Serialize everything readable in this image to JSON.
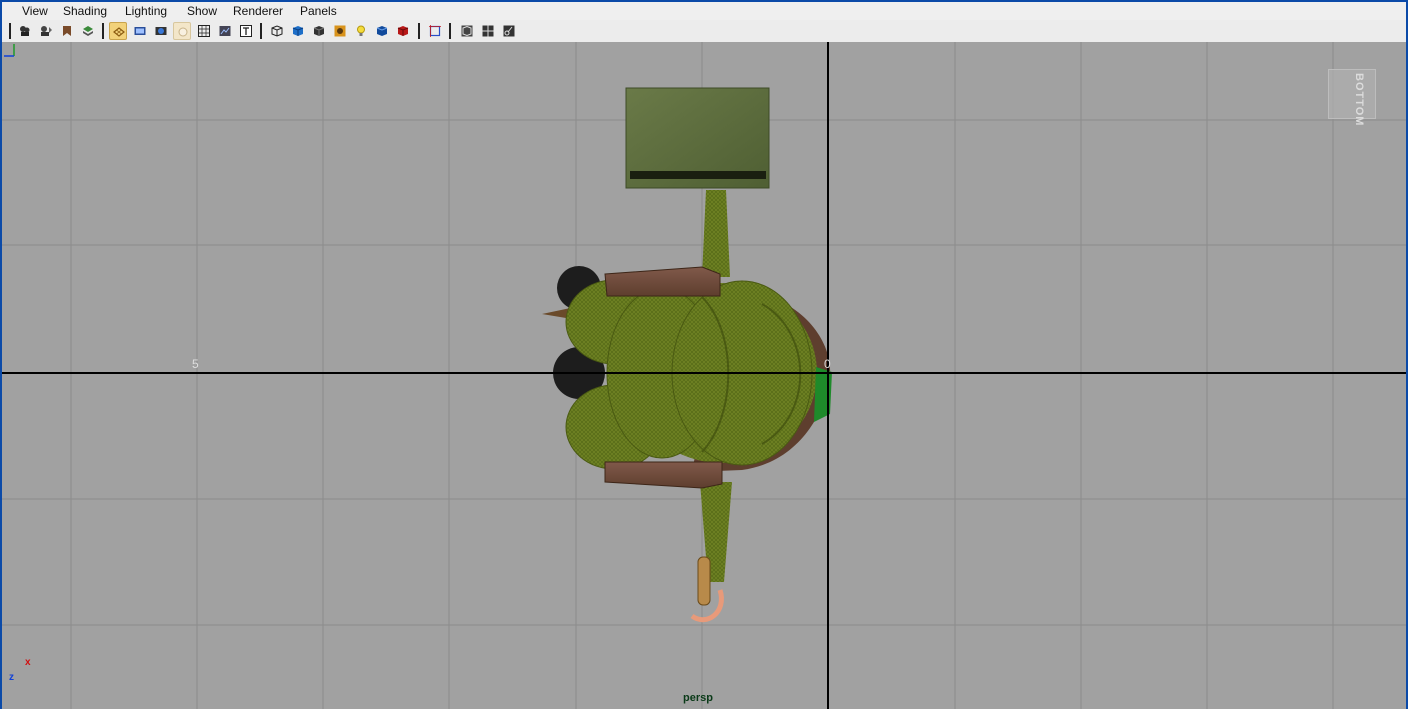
{
  "menubar": {
    "items": [
      "View",
      "Shading",
      "Lighting",
      "Show",
      "Renderer",
      "Panels"
    ]
  },
  "toolbar": {
    "icons": [
      "select-camera-icon",
      "camera-attributes-icon",
      "bookmark-icon",
      "image-plane-icon",
      "grid-icon",
      "film-gate-icon",
      "resolution-gate-icon",
      "gate-mask-icon",
      "wireframe-icon",
      "smooth-shade-icon",
      "texture-icon",
      "use-default-material-icon",
      "wireframe-on-shaded-icon",
      "smooth-shade-all-icon",
      "xray-icon",
      "shadows-icon",
      "all-lights-icon",
      "high-quality-icon",
      "isolate-select-icon",
      "single-view-icon",
      "four-view-icon",
      "outliner-layout-icon"
    ]
  },
  "viewport": {
    "view_cube_label": "BOTTOM",
    "grid_labels": {
      "left": "5",
      "origin": "0"
    },
    "camera_name": "persp",
    "axis_labels": {
      "x": "x",
      "z": "z"
    },
    "colors": {
      "background": "#a1a1a1",
      "grid": "#8a8a8a",
      "axis": "#000000",
      "model_green": "#6b7f1f",
      "crate": "#5d6d3e",
      "wood": "#6e4a36"
    }
  }
}
